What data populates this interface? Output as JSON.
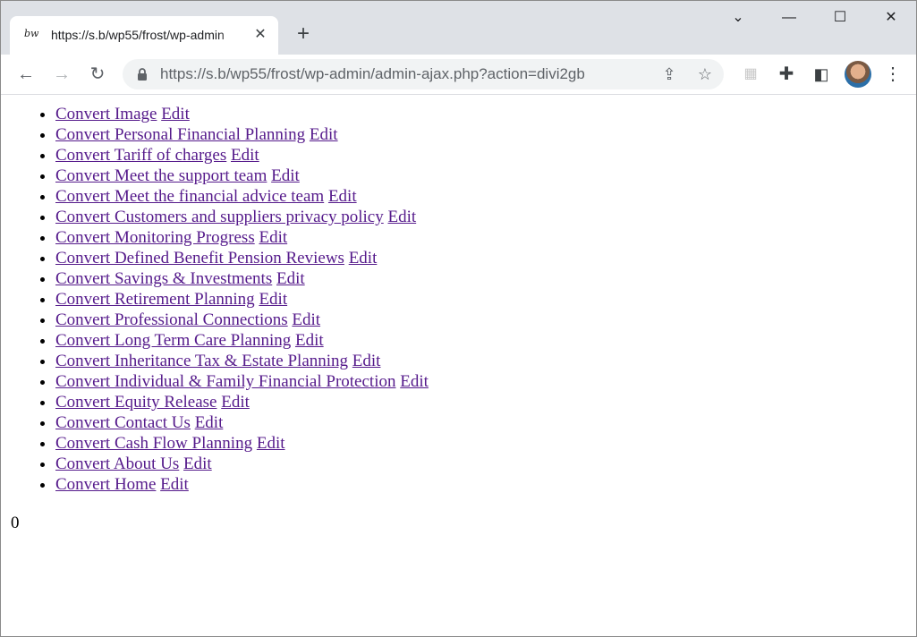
{
  "browser": {
    "tab_title": "https://s.b/wp55/frost/wp-admin",
    "favicon_text": "bw",
    "url": "https://s.b/wp55/frost/wp-admin/admin-ajax.php?action=divi2gb"
  },
  "links": [
    {
      "convert": "Convert Image",
      "edit": "Edit"
    },
    {
      "convert": "Convert Personal Financial Planning",
      "edit": "Edit"
    },
    {
      "convert": "Convert Tariff of charges",
      "edit": "Edit"
    },
    {
      "convert": "Convert Meet the support team",
      "edit": "Edit"
    },
    {
      "convert": "Convert Meet the financial advice team",
      "edit": "Edit"
    },
    {
      "convert": "Convert Customers and suppliers privacy policy",
      "edit": "Edit"
    },
    {
      "convert": "Convert Monitoring Progress",
      "edit": "Edit"
    },
    {
      "convert": "Convert Defined Benefit Pension Reviews",
      "edit": "Edit"
    },
    {
      "convert": "Convert Savings & Investments",
      "edit": "Edit"
    },
    {
      "convert": "Convert Retirement Planning",
      "edit": "Edit"
    },
    {
      "convert": "Convert Professional Connections",
      "edit": "Edit"
    },
    {
      "convert": "Convert Long Term Care Planning",
      "edit": "Edit"
    },
    {
      "convert": "Convert Inheritance Tax & Estate Planning",
      "edit": "Edit"
    },
    {
      "convert": "Convert Individual & Family Financial Protection",
      "edit": "Edit"
    },
    {
      "convert": "Convert Equity Release",
      "edit": "Edit"
    },
    {
      "convert": "Convert Contact Us",
      "edit": "Edit"
    },
    {
      "convert": "Convert Cash Flow Planning",
      "edit": "Edit"
    },
    {
      "convert": "Convert About Us",
      "edit": "Edit"
    },
    {
      "convert": "Convert Home",
      "edit": "Edit"
    }
  ],
  "result": "0",
  "colors": {
    "visited_link": "#551a8b",
    "chrome_frame": "#dee1e6"
  }
}
